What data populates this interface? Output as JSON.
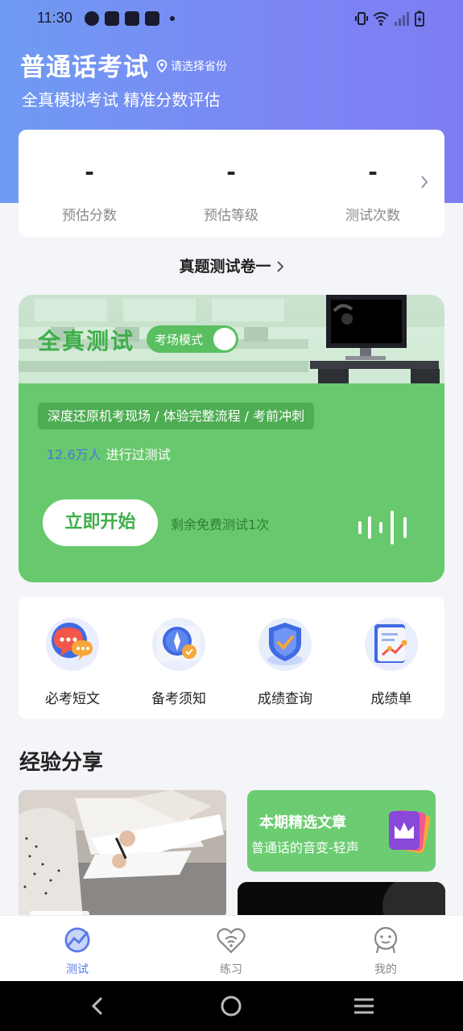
{
  "status_bar": {
    "time": "11:30"
  },
  "header": {
    "title": "普通话考试",
    "location": "请选择省份",
    "subtitle": "全真模拟考试 精准分数评估"
  },
  "stats": [
    {
      "value": "-",
      "label": "预估分数"
    },
    {
      "value": "-",
      "label": "预估等级"
    },
    {
      "value": "-",
      "label": "测试次数"
    }
  ],
  "paper_link": "真题测试卷一",
  "exam_card": {
    "title": "全真测试",
    "mode_label": "考场模式",
    "mode_on": true,
    "tagline": "深度还原机考现场 / 体验完整流程 / 考前冲刺",
    "count_number": "12.6万人",
    "count_suffix": "进行过测试",
    "start_label": "立即开始",
    "free_left": "剩余免费测试1次"
  },
  "actions": [
    {
      "label": "必考短文",
      "icon": "chat-bubbles-icon"
    },
    {
      "label": "备考须知",
      "icon": "compass-book-icon"
    },
    {
      "label": "成绩查询",
      "icon": "shield-check-icon"
    },
    {
      "label": "成绩单",
      "icon": "scroll-chart-icon"
    }
  ],
  "experience": {
    "title": "经验分享",
    "article_title": "本期精选文章",
    "article_subtitle": "普通话的音变-轻声"
  },
  "tabs": [
    {
      "label": "测试",
      "active": true
    },
    {
      "label": "练习",
      "active": false
    },
    {
      "label": "我的",
      "active": false
    }
  ],
  "colors": {
    "header_start": "#6f9bf3",
    "header_end": "#7d7df2",
    "green": "#68c86d",
    "accent_blue": "#5a79e6"
  }
}
